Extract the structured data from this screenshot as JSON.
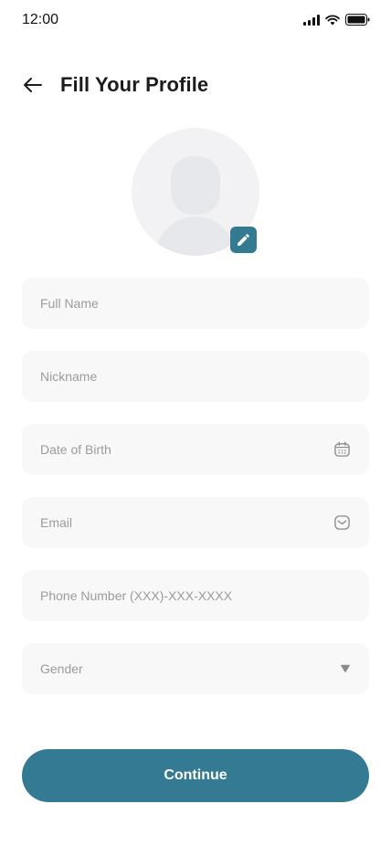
{
  "status_bar": {
    "time": "12:00"
  },
  "header": {
    "title": "Fill Your Profile"
  },
  "form": {
    "full_name": {
      "placeholder": "Full Name",
      "value": ""
    },
    "nickname": {
      "placeholder": "Nickname",
      "value": ""
    },
    "date_of_birth": {
      "placeholder": "Date of Birth",
      "value": "",
      "icon": "calendar-icon"
    },
    "email": {
      "placeholder": "Email",
      "value": "",
      "icon": "mail-icon"
    },
    "phone": {
      "placeholder": "Phone Number (XXX)-XXX-XXXX",
      "value": ""
    },
    "gender": {
      "selected": "Gender",
      "icon": "dropdown-arrow-icon"
    }
  },
  "buttons": {
    "continue_label": "Continue"
  },
  "colors": {
    "accent": "#357A93",
    "field_bg": "#F8F8F8",
    "avatar_bg": "#F2F2F4",
    "placeholder": "#9B9B9B"
  }
}
